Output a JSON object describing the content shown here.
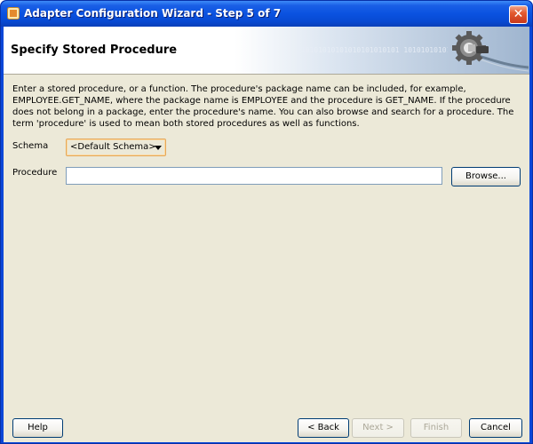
{
  "window": {
    "title": "Adapter Configuration Wizard - Step 5 of 7",
    "close_glyph": "✕"
  },
  "header": {
    "title": "Specify Stored Procedure",
    "binary_decoration": "010101010101010101010101 10101010101010101010"
  },
  "description": "Enter a stored procedure, or a function. The procedure's package name can be included, for example, EMPLOYEE.GET_NAME, where the package name is EMPLOYEE and the procedure is GET_NAME.  If the procedure does not belong in a package, enter the procedure's name. You can also browse and search for a procedure. The term 'procedure' is used to mean both stored procedures as well as functions.",
  "form": {
    "schema_label": "Schema",
    "schema_value": "<Default Schema>",
    "procedure_label": "Procedure",
    "procedure_value": "",
    "browse_label": "Browse..."
  },
  "footer": {
    "help_label": "Help",
    "back_label": "< Back",
    "next_label": "Next >",
    "finish_label": "Finish",
    "cancel_label": "Cancel"
  },
  "icons": {
    "title_icon": "app-window-icon",
    "header_icon": "gear-plug-icon"
  }
}
